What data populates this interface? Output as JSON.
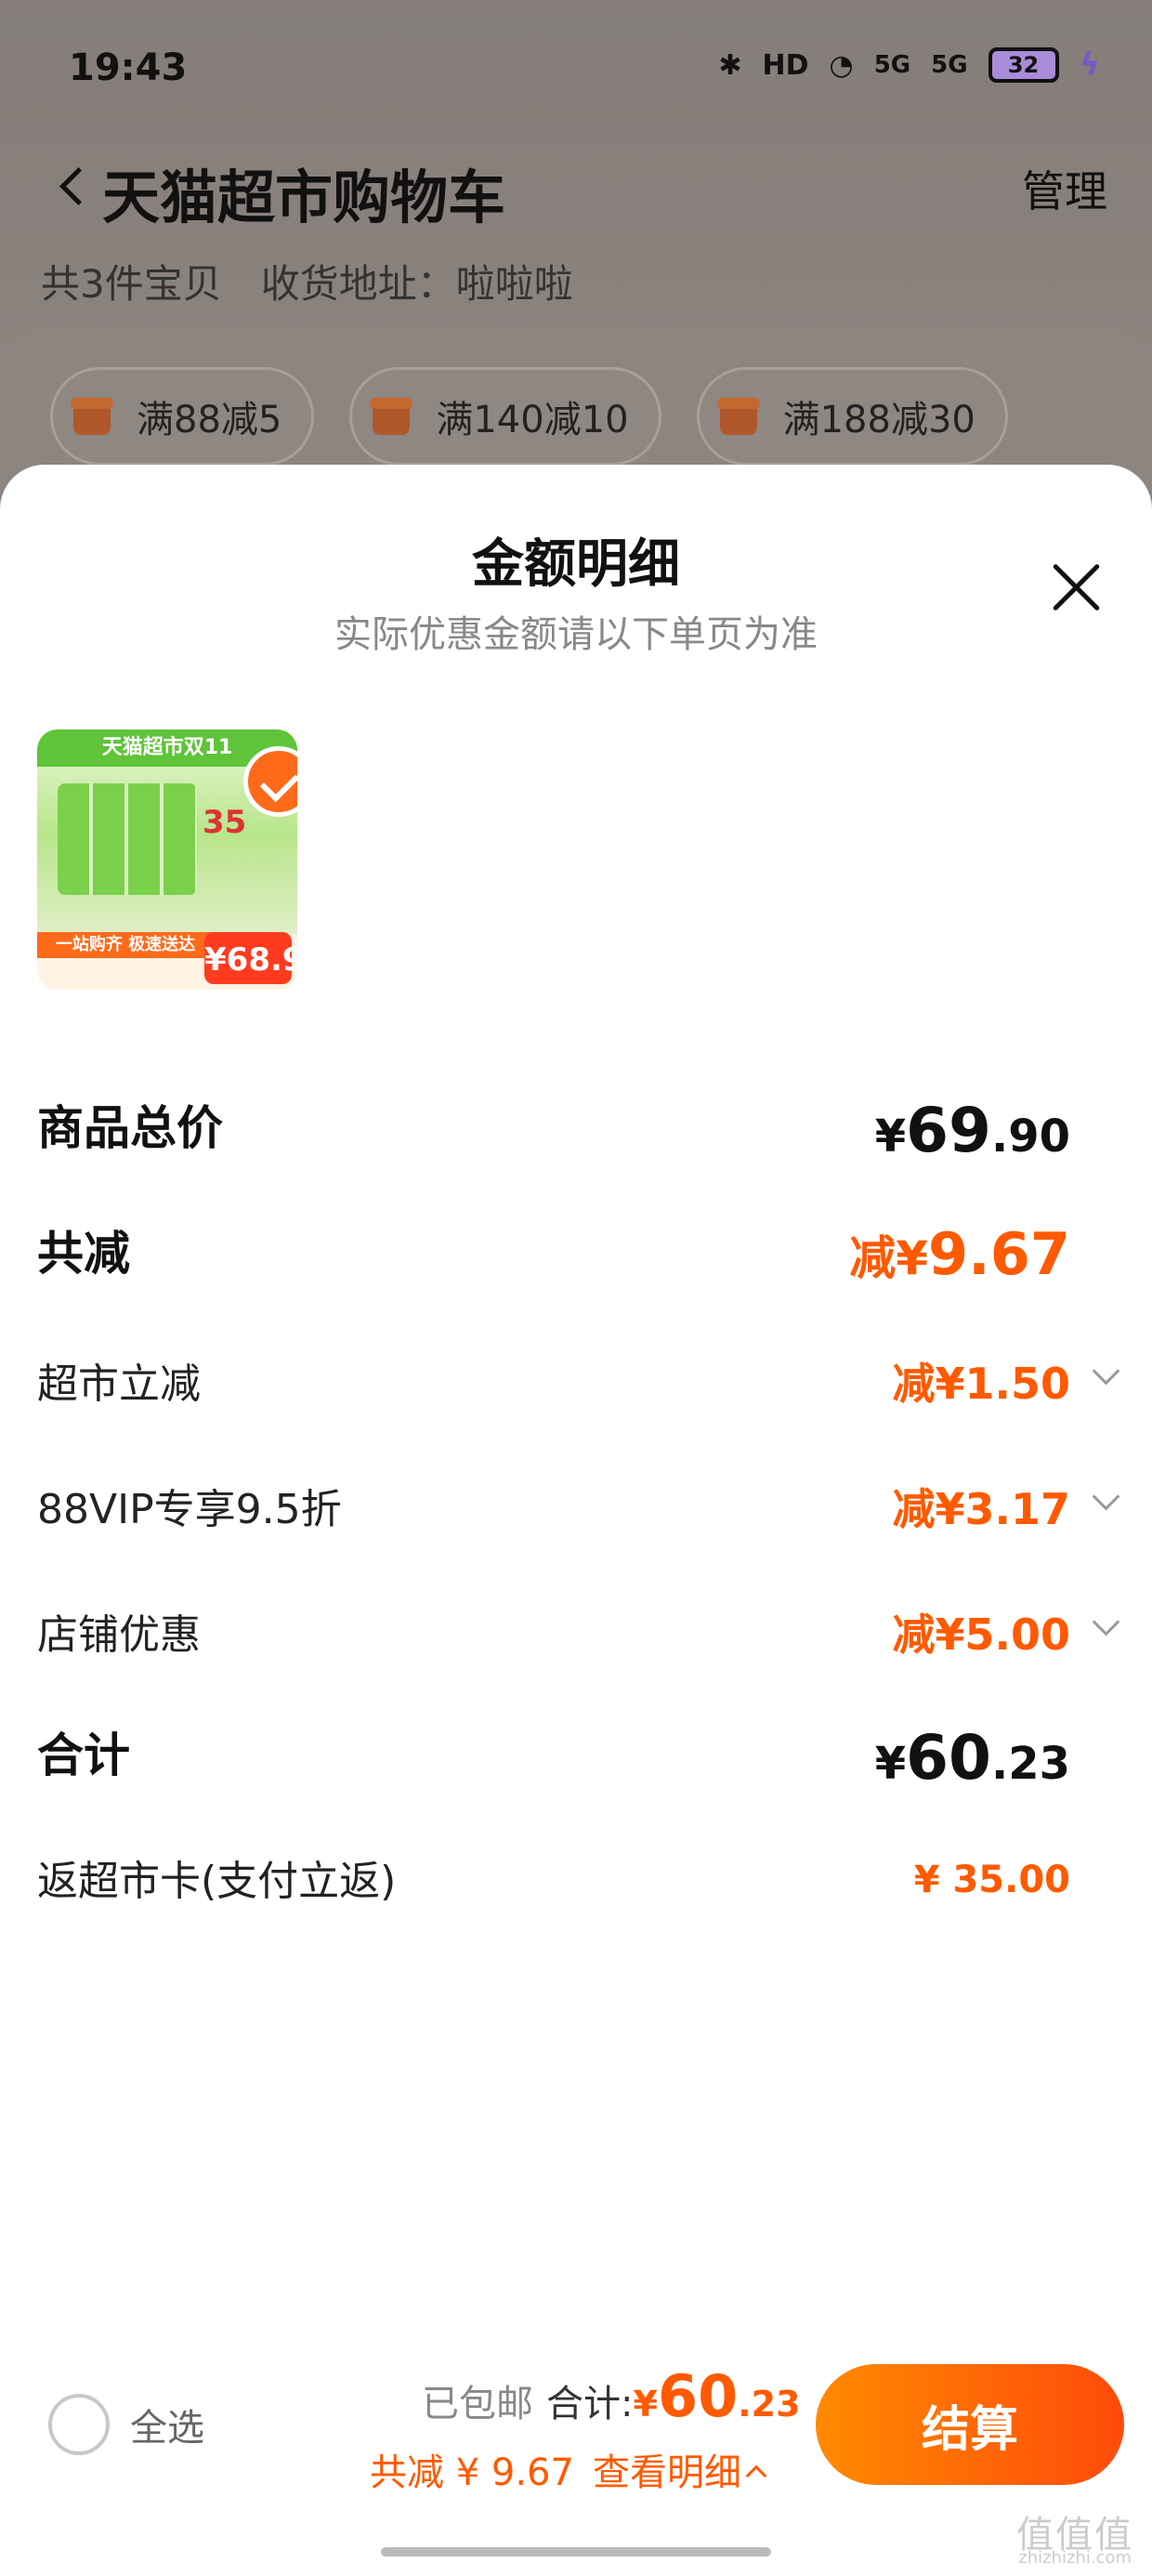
{
  "status_bar": {
    "time": "19:43",
    "hd_label": "HD",
    "signal1": "5G",
    "signal2": "5G",
    "battery": "32"
  },
  "header": {
    "title": "天猫超市购物车",
    "manage": "管理",
    "item_count": "共3件宝贝",
    "address": "收货地址：啦啦啦"
  },
  "promos": [
    "满88减5",
    "满140减10",
    "满188减30"
  ],
  "sheet": {
    "title": "金额明细",
    "subtitle": "实际优惠金额请以下单页为准"
  },
  "product": {
    "banner": "天猫超市双11",
    "card_amount": "35",
    "band_text": "一站购齐 极速送达",
    "price": "68.9",
    "selected": true
  },
  "breakdown": {
    "total_price": {
      "label": "商品总价",
      "yen": "¥",
      "int": "69",
      "dec": ".90"
    },
    "total_discount": {
      "label": "共减",
      "prefix": "减¥",
      "amount": "9.67"
    },
    "items": [
      {
        "label": "超市立减",
        "prefix": "减¥",
        "amount": "1.50"
      },
      {
        "label": "88VIP专享9.5折",
        "prefix": "减¥",
        "amount": "3.17"
      },
      {
        "label": "店铺优惠",
        "prefix": "减¥",
        "amount": "5.00"
      }
    ],
    "sum": {
      "label": "合计",
      "yen": "¥",
      "int": "60",
      "dec": ".23"
    },
    "rebate": {
      "label": "返超市卡(支付立返)",
      "amount": "¥ 35.00"
    }
  },
  "footer": {
    "select_all": "全选",
    "free_shipping": "已包邮",
    "total_label": "合计:",
    "total_yen": "¥",
    "total_int": "60",
    "total_dec": ".23",
    "discount_text": "共减 ¥ 9.67",
    "detail_link": "查看明细",
    "checkout": "结算"
  },
  "watermark": {
    "text": "值值值",
    "sub": "zhizhizhi.com"
  },
  "colors": {
    "accent": "#ff5a00",
    "checkout_start": "#ff8a00",
    "checkout_end": "#ff4a0a"
  }
}
